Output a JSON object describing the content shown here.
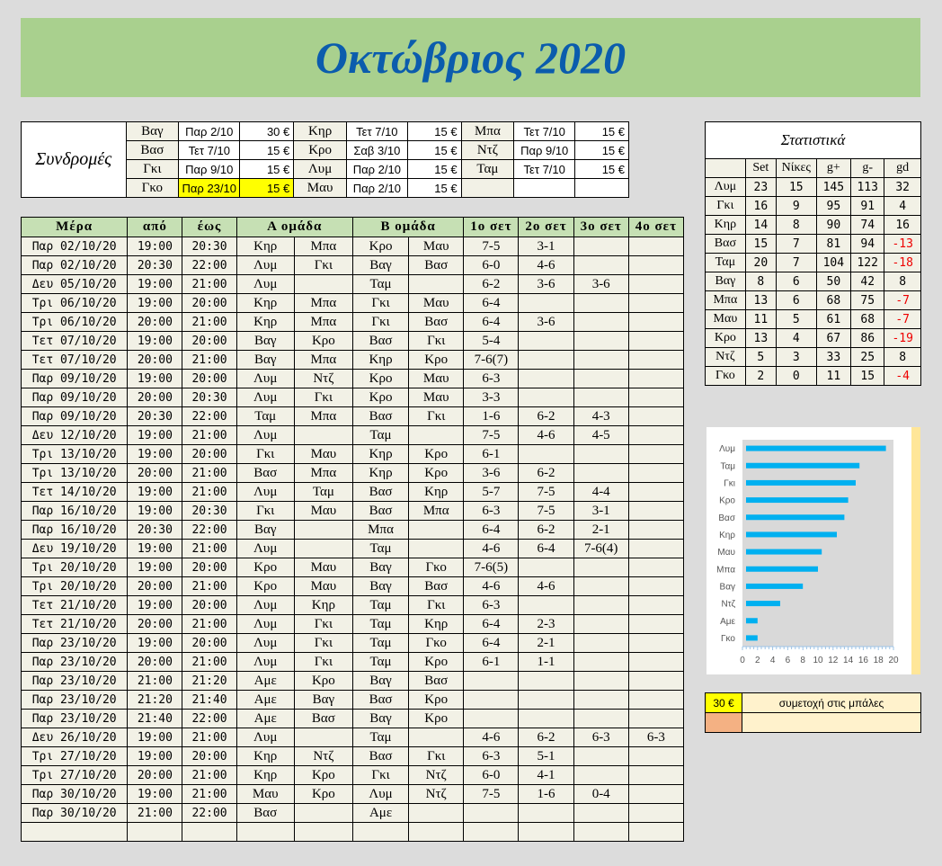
{
  "title": "Οκτώβριος 2020",
  "subscriptions": {
    "label": "Συνδρομές",
    "rows": [
      [
        [
          "Βαγ",
          "Παρ 2/10",
          "30 €"
        ],
        [
          "Κηρ",
          "Τετ 7/10",
          "15 €"
        ],
        [
          "Μπα",
          "Τετ 7/10",
          "15 €"
        ]
      ],
      [
        [
          "Βασ",
          "Τετ 7/10",
          "15 €"
        ],
        [
          "Κρο",
          "Σαβ 3/10",
          "15 €"
        ],
        [
          "Ντζ",
          "Παρ 9/10",
          "15 €"
        ]
      ],
      [
        [
          "Γκι",
          "Παρ 9/10",
          "15 €"
        ],
        [
          "Λυμ",
          "Παρ 2/10",
          "15 €"
        ],
        [
          "Ταμ",
          "Τετ 7/10",
          "15 €"
        ]
      ],
      [
        [
          "Γκο",
          "Παρ 23/10",
          "15 €"
        ],
        [
          "Μαυ",
          "Παρ 2/10",
          "15 €"
        ],
        [
          "",
          "",
          ""
        ]
      ]
    ],
    "highlight_color": "#ffff00"
  },
  "schedule": {
    "headers": [
      "Μέρα",
      "από",
      "έως",
      "Α ομάδα",
      "Β ομάδα",
      "1ο σετ",
      "2ο σετ",
      "3ο σετ",
      "4ο σετ"
    ],
    "rows": [
      [
        "Παρ 02/10/20",
        "19:00",
        "20:30",
        "Κηρ",
        "Μπα",
        "Κρο",
        "Μαυ",
        "7-5",
        "3-1",
        "",
        ""
      ],
      [
        "Παρ 02/10/20",
        "20:30",
        "22:00",
        "Λυμ",
        "Γκι",
        "Βαγ",
        "Βασ",
        "6-0",
        "4-6",
        "",
        ""
      ],
      [
        "Δευ 05/10/20",
        "19:00",
        "21:00",
        "Λυμ",
        "",
        "Ταμ",
        "",
        "6-2",
        "3-6",
        "3-6",
        ""
      ],
      [
        "Τρι 06/10/20",
        "19:00",
        "20:00",
        "Κηρ",
        "Μπα",
        "Γκι",
        "Μαυ",
        "6-4",
        "",
        "",
        ""
      ],
      [
        "Τρι 06/10/20",
        "20:00",
        "21:00",
        "Κηρ",
        "Μπα",
        "Γκι",
        "Βασ",
        "6-4",
        "3-6",
        "",
        ""
      ],
      [
        "Τετ 07/10/20",
        "19:00",
        "20:00",
        "Βαγ",
        "Κρο",
        "Βασ",
        "Γκι",
        "5-4",
        "",
        "",
        ""
      ],
      [
        "Τετ 07/10/20",
        "20:00",
        "21:00",
        "Βαγ",
        "Μπα",
        "Κηρ",
        "Κρο",
        "7-6(7)",
        "",
        "",
        ""
      ],
      [
        "Παρ 09/10/20",
        "19:00",
        "20:00",
        "Λυμ",
        "Ντζ",
        "Κρο",
        "Μαυ",
        "6-3",
        "",
        "",
        ""
      ],
      [
        "Παρ 09/10/20",
        "20:00",
        "20:30",
        "Λυμ",
        "Γκι",
        "Κρο",
        "Μαυ",
        "3-3",
        "",
        "",
        ""
      ],
      [
        "Παρ 09/10/20",
        "20:30",
        "22:00",
        "Ταμ",
        "Μπα",
        "Βασ",
        "Γκι",
        "1-6",
        "6-2",
        "4-3",
        ""
      ],
      [
        "Δευ 12/10/20",
        "19:00",
        "21:00",
        "Λυμ",
        "",
        "Ταμ",
        "",
        "7-5",
        "4-6",
        "4-5",
        ""
      ],
      [
        "Τρι 13/10/20",
        "19:00",
        "20:00",
        "Γκι",
        "Μαυ",
        "Κηρ",
        "Κρο",
        "6-1",
        "",
        "",
        ""
      ],
      [
        "Τρι 13/10/20",
        "20:00",
        "21:00",
        "Βασ",
        "Μπα",
        "Κηρ",
        "Κρο",
        "3-6",
        "6-2",
        "",
        ""
      ],
      [
        "Τετ 14/10/20",
        "19:00",
        "21:00",
        "Λυμ",
        "Ταμ",
        "Βασ",
        "Κηρ",
        "5-7",
        "7-5",
        "4-4",
        ""
      ],
      [
        "Παρ 16/10/20",
        "19:00",
        "20:30",
        "Γκι",
        "Μαυ",
        "Βασ",
        "Μπα",
        "6-3",
        "7-5",
        "3-1",
        ""
      ],
      [
        "Παρ 16/10/20",
        "20:30",
        "22:00",
        "Βαγ",
        "",
        "Μπα",
        "",
        "6-4",
        "6-2",
        "2-1",
        ""
      ],
      [
        "Δευ 19/10/20",
        "19:00",
        "21:00",
        "Λυμ",
        "",
        "Ταμ",
        "",
        "4-6",
        "6-4",
        "7-6(4)",
        ""
      ],
      [
        "Τρι 20/10/20",
        "19:00",
        "20:00",
        "Κρο",
        "Μαυ",
        "Βαγ",
        "Γκο",
        "7-6(5)",
        "",
        "",
        ""
      ],
      [
        "Τρι 20/10/20",
        "20:00",
        "21:00",
        "Κρο",
        "Μαυ",
        "Βαγ",
        "Βασ",
        "4-6",
        "4-6",
        "",
        ""
      ],
      [
        "Τετ 21/10/20",
        "19:00",
        "20:00",
        "Λυμ",
        "Κηρ",
        "Ταμ",
        "Γκι",
        "6-3",
        "",
        "",
        ""
      ],
      [
        "Τετ 21/10/20",
        "20:00",
        "21:00",
        "Λυμ",
        "Γκι",
        "Ταμ",
        "Κηρ",
        "6-4",
        "2-3",
        "",
        ""
      ],
      [
        "Παρ 23/10/20",
        "19:00",
        "20:00",
        "Λυμ",
        "Γκι",
        "Ταμ",
        "Γκο",
        "6-4",
        "2-1",
        "",
        ""
      ],
      [
        "Παρ 23/10/20",
        "20:00",
        "21:00",
        "Λυμ",
        "Γκι",
        "Ταμ",
        "Κρο",
        "6-1",
        "1-1",
        "",
        ""
      ],
      [
        "Παρ 23/10/20",
        "21:00",
        "21:20",
        "Αμε",
        "Κρο",
        "Βαγ",
        "Βασ",
        "",
        "",
        "",
        ""
      ],
      [
        "Παρ 23/10/20",
        "21:20",
        "21:40",
        "Αμε",
        "Βαγ",
        "Βασ",
        "Κρο",
        "",
        "",
        "",
        ""
      ],
      [
        "Παρ 23/10/20",
        "21:40",
        "22:00",
        "Αμε",
        "Βασ",
        "Βαγ",
        "Κρο",
        "",
        "",
        "",
        ""
      ],
      [
        "Δευ 26/10/20",
        "19:00",
        "21:00",
        "Λυμ",
        "",
        "Ταμ",
        "",
        "4-6",
        "6-2",
        "6-3",
        "6-3"
      ],
      [
        "Τρι 27/10/20",
        "19:00",
        "20:00",
        "Κηρ",
        "Ντζ",
        "Βασ",
        "Γκι",
        "6-3",
        "5-1",
        "",
        ""
      ],
      [
        "Τρι 27/10/20",
        "20:00",
        "21:00",
        "Κηρ",
        "Κρο",
        "Γκι",
        "Ντζ",
        "6-0",
        "4-1",
        "",
        ""
      ],
      [
        "Παρ 30/10/20",
        "19:00",
        "21:00",
        "Μαυ",
        "Κρο",
        "Λυμ",
        "Ντζ",
        "7-5",
        "1-6",
        "0-4",
        ""
      ],
      [
        "Παρ 30/10/20",
        "21:00",
        "22:00",
        "Βασ",
        "",
        "Αμε",
        "",
        "",
        "",
        "",
        ""
      ],
      [
        "",
        "",
        "",
        "",
        "",
        "",
        "",
        "",
        "",
        "",
        ""
      ]
    ]
  },
  "stats": {
    "caption": "Στατιστικά",
    "headers": [
      "",
      "Set",
      "Νίκες",
      "g+",
      "g-",
      "gd"
    ],
    "rows": [
      [
        "Λυμ",
        "23",
        "15",
        "145",
        "113",
        "32"
      ],
      [
        "Γκι",
        "16",
        "9",
        "95",
        "91",
        "4"
      ],
      [
        "Κηρ",
        "14",
        "8",
        "90",
        "74",
        "16"
      ],
      [
        "Βασ",
        "15",
        "7",
        "81",
        "94",
        "-13"
      ],
      [
        "Ταμ",
        "20",
        "7",
        "104",
        "122",
        "-18"
      ],
      [
        "Βαγ",
        "8",
        "6",
        "50",
        "42",
        "8"
      ],
      [
        "Μπα",
        "13",
        "6",
        "68",
        "75",
        "-7"
      ],
      [
        "Μαυ",
        "11",
        "5",
        "61",
        "68",
        "-7"
      ],
      [
        "Κρο",
        "13",
        "4",
        "67",
        "86",
        "-19"
      ],
      [
        "Ντζ",
        "5",
        "3",
        "33",
        "25",
        "8"
      ],
      [
        "Γκο",
        "2",
        "0",
        "11",
        "15",
        "-4"
      ]
    ],
    "negative_color": "#ee0000"
  },
  "chart_data": {
    "type": "bar",
    "orientation": "horizontal",
    "categories": [
      "Λυμ",
      "Ταμ",
      "Γκι",
      "Κρο",
      "Βασ",
      "Κηρ",
      "Μαυ",
      "Μπα",
      "Βαγ",
      "Ντζ",
      "Αμε",
      "Γκο"
    ],
    "values": [
      19,
      15.5,
      15,
      14,
      13.5,
      12.5,
      10.5,
      10,
      8,
      5,
      2,
      2
    ],
    "xlim": [
      0,
      20
    ],
    "xticks": [
      "0",
      "2",
      "4",
      "6",
      "8",
      "10",
      "12",
      "14",
      "16",
      "18",
      "20"
    ],
    "bar_color": "#00b0f0",
    "plot_bg": "#d9d9d9"
  },
  "participation": {
    "amount": "30 €",
    "label": "συμετοχή στις μπάλες"
  }
}
